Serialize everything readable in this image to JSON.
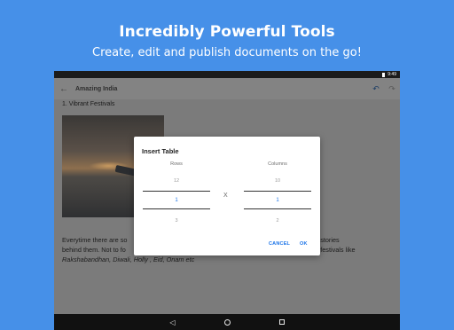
{
  "promo": {
    "title": "Incredibly Powerful Tools",
    "subtitle": "Create, edit and publish documents on the go!"
  },
  "statusbar": {
    "time": "9:49"
  },
  "appbar": {
    "back_icon": "arrow-left-icon",
    "title": "Amazing India",
    "undo_icon": "undo-icon",
    "redo_icon": "redo-icon"
  },
  "document": {
    "heading": "1. Vibrant Festivals",
    "para_line1_left": "Everytime there are so",
    "para_line1_right": "religious stories",
    "para_line2_left": "behind them. Not to fo",
    "para_line2_right": "all these festivals like",
    "para_line3": "Rakshabandhan, Diwali, Holly , Eid, Onam etc"
  },
  "dialog": {
    "title": "Insert Table",
    "rows_label": "Rows",
    "columns_label": "Columns",
    "rows_above": "12",
    "rows_selected": "1",
    "rows_below": "3",
    "cols_above": "10",
    "cols_selected": "1",
    "cols_below": "2",
    "x_label": "X",
    "cancel_label": "CANCEL",
    "ok_label": "OK"
  },
  "colors": {
    "background": "#4690e8",
    "accent": "#1a73e8"
  }
}
